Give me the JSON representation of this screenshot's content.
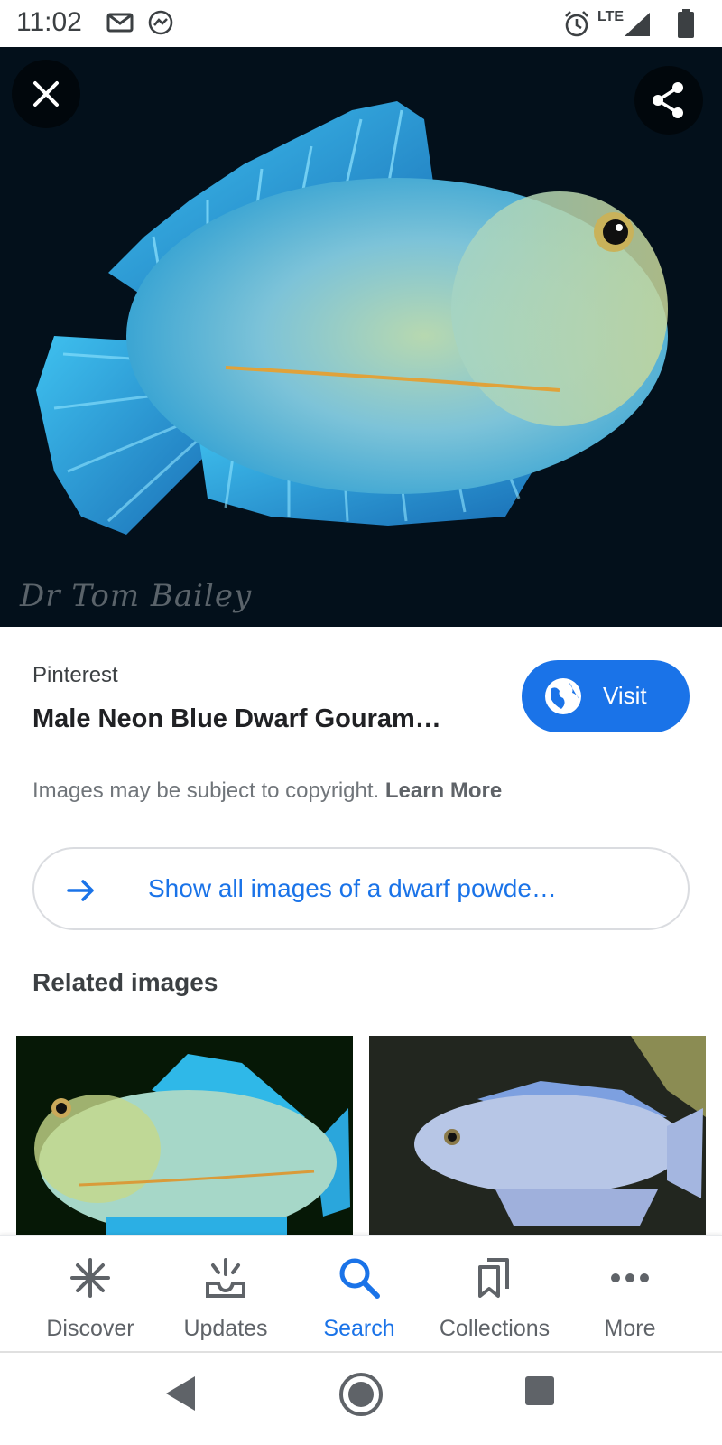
{
  "status_bar": {
    "time": "11:02",
    "network": "LTE",
    "icons": [
      "gmail-icon",
      "messenger-icon",
      "alarm-icon",
      "signal-icon",
      "battery-icon"
    ]
  },
  "viewer": {
    "image_alt": "neon blue dwarf gourami fish",
    "watermark": "Dr Tom Bailey",
    "close_icon": "close-icon",
    "share_icon": "share-icon"
  },
  "result": {
    "source": "Pinterest",
    "title": "Male Neon Blue Dwarf Gouram…",
    "visit_label": "Visit",
    "copyright_text": "Images may be subject to copyright.",
    "learn_more": "Learn More",
    "show_all_label": "Show all images of a dwarf powde…"
  },
  "related": {
    "heading": "Related images"
  },
  "bottom_nav": {
    "items": [
      {
        "label": "Discover",
        "icon": "asterisk-icon"
      },
      {
        "label": "Updates",
        "icon": "updates-icon"
      },
      {
        "label": "Search",
        "icon": "search-icon"
      },
      {
        "label": "Collections",
        "icon": "collections-icon"
      },
      {
        "label": "More",
        "icon": "more-icon"
      }
    ],
    "active": "Search"
  },
  "colors": {
    "accent": "#1a73e8",
    "text_primary": "#202124",
    "text_secondary": "#70757a"
  }
}
